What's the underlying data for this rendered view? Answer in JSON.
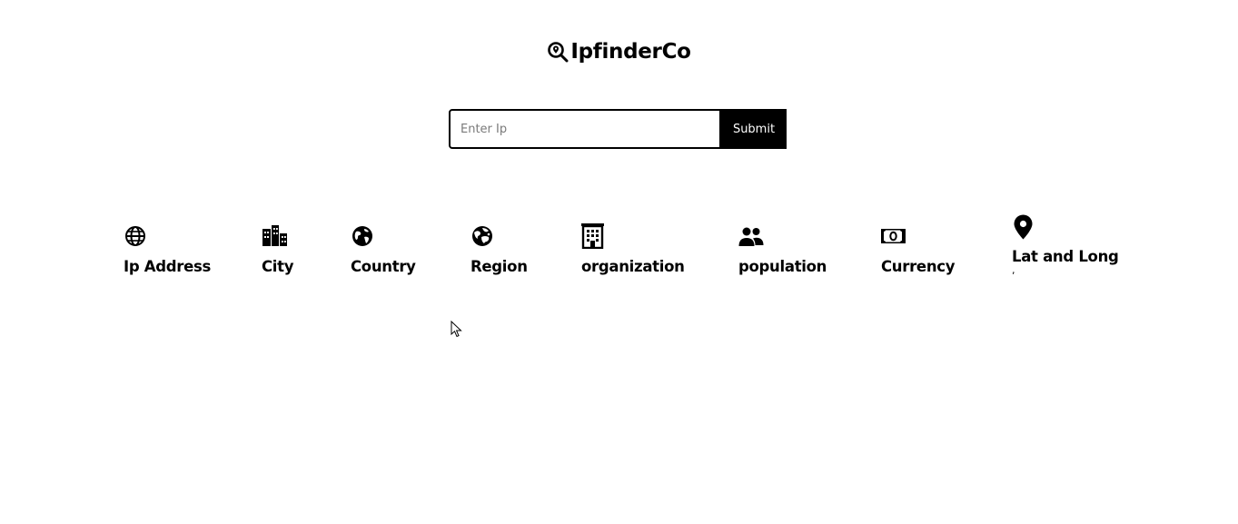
{
  "header": {
    "logo_icon": "search-location-icon",
    "title": "IpfinderCo"
  },
  "search": {
    "placeholder": "Enter Ip",
    "value": "",
    "submit_label": "Submit"
  },
  "info": {
    "items": [
      {
        "label": "Ip Address",
        "icon": "globe-icon",
        "value": ""
      },
      {
        "label": "City",
        "icon": "city-icon",
        "value": ""
      },
      {
        "label": "Country",
        "icon": "earth-icon",
        "value": ""
      },
      {
        "label": "Region",
        "icon": "world-map-icon",
        "value": ""
      },
      {
        "label": "organization",
        "icon": "building-icon",
        "value": ""
      },
      {
        "label": "population",
        "icon": "users-icon",
        "value": ""
      },
      {
        "label": "Currency",
        "icon": "money-bill-icon",
        "value": ""
      },
      {
        "label": "Lat and Long",
        "icon": "map-pin-icon",
        "value": ","
      }
    ]
  }
}
